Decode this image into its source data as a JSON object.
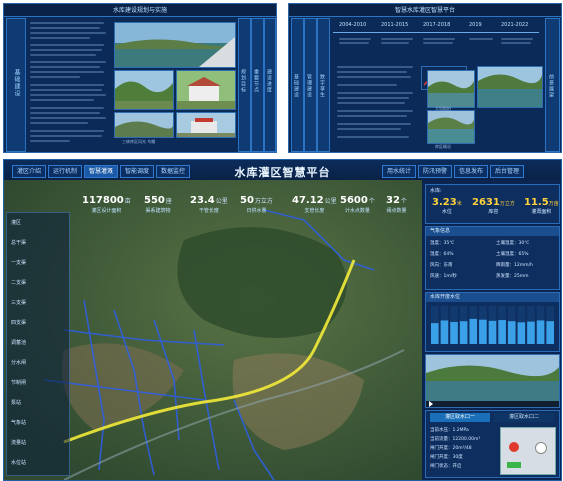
{
  "top_left": {
    "title": "水库建设规划与实施",
    "vertical_left": "基础建设",
    "vertical_right": [
      "规划目标",
      "重要节点",
      "建设进度"
    ],
    "caption": "三峡库区风光 鸟瞰"
  },
  "top_right": {
    "title": "智慧水库灌区智慧平台",
    "vertical_left": [
      "基础建设",
      "管理建设",
      "数字孪生"
    ],
    "vertical_right": "前景展望",
    "timeline": [
      "2004-2010",
      "2011-2015",
      "2017-2018",
      "2019",
      "2021-2022"
    ],
    "captions": [
      "大坝航拍",
      "库区概况"
    ]
  },
  "dashboard": {
    "title": "水库灌区智慧平台",
    "tabs_left": [
      "灌区介绍",
      "运行机制",
      "智慧灌溉",
      "智能调度",
      "数据监控"
    ],
    "tabs_right": [
      "用水统计",
      "防汛预警",
      "信息发布",
      "后台管理"
    ],
    "active_tab": 2,
    "stats": [
      {
        "value": "117800",
        "unit": "亩",
        "label": "灌区设计面积"
      },
      {
        "value": "550",
        "unit": "座",
        "label": "渠系建筑物"
      },
      {
        "value": "23.4",
        "unit": "公里",
        "label": "干管长度"
      },
      {
        "value": "50",
        "unit": "万立方",
        "label": "日供水量"
      },
      {
        "value": "47.12",
        "unit": "公里",
        "label": "支管长度"
      },
      {
        "value": "5600",
        "unit": "个",
        "label": "计水点数量"
      },
      {
        "value": "32",
        "unit": "个",
        "label": "阀点数量"
      }
    ],
    "left_list": [
      "灌区",
      "总干渠",
      "一支渠",
      "二支渠",
      "三支渠",
      "四支渠",
      "调蓄池",
      "分水闸",
      "节制闸",
      "泵站",
      "气象站",
      "流量站",
      "水位站"
    ],
    "water": {
      "label": "水库:",
      "items": [
        {
          "value": "3.23",
          "unit": "米",
          "label": "水位"
        },
        {
          "value": "2631",
          "unit": "万立方",
          "label": "库容"
        },
        {
          "value": "11.5",
          "unit": "万亩",
          "label": "灌溉面积"
        }
      ]
    },
    "weather": {
      "title": "气象信息",
      "items": [
        "温度：35℃",
        "土壤温度：30℃",
        "湿度：64%",
        "土壤湿度：65%",
        "风向：东南",
        "降雨量：12mm/h",
        "风速：1m/秒",
        "蒸发量：25mm"
      ]
    },
    "level_chart": {
      "title": "水库开度水位",
      "bars": [
        0.55,
        0.62,
        0.58,
        0.6,
        0.66,
        0.64,
        0.61,
        0.63,
        0.6,
        0.57,
        0.59,
        0.62,
        0.6
      ]
    },
    "gates": {
      "tabs": [
        "灌区取水口一",
        "灌区取水口二"
      ],
      "items": [
        "当前水压：1.2MPa",
        "当前流量：12200.00m³",
        "闸门开度：20m³/48",
        "闸门开度：30度",
        "闸门状态：开启"
      ]
    }
  }
}
